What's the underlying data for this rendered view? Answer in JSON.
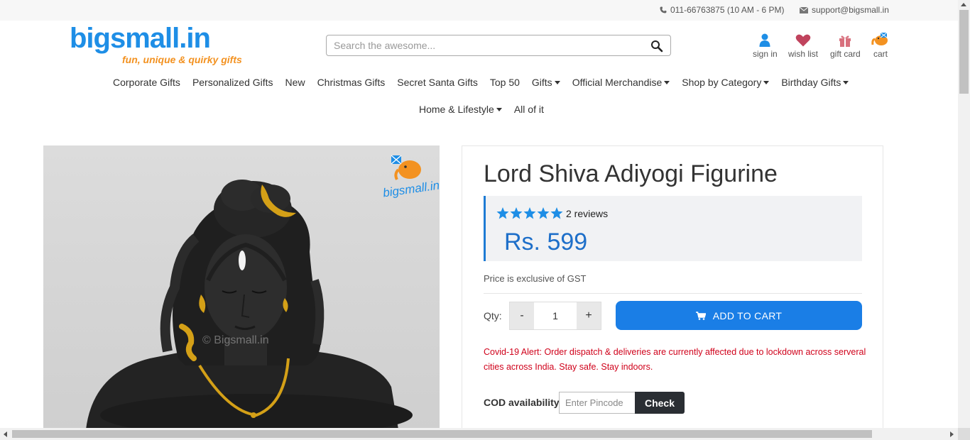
{
  "topbar": {
    "phone": "011-66763875 (10 AM - 6 PM)",
    "email": "support@bigsmall.in",
    "phone_icon": "phone-icon",
    "email_icon": "envelope-icon"
  },
  "header": {
    "logo_text": "bigsmall.in",
    "logo_tagline": "fun, unique & quirky gifts",
    "search_placeholder": "Search the awesome...",
    "search_icon": "magnifier-icon",
    "icons": [
      {
        "label": "sign in",
        "icon": "user-icon"
      },
      {
        "label": "wish list",
        "icon": "heart-icon"
      },
      {
        "label": "gift card",
        "icon": "gift-icon"
      },
      {
        "label": "cart",
        "icon": "cart-elephant-icon"
      }
    ]
  },
  "nav": {
    "row1": [
      {
        "label": "Corporate Gifts",
        "dropdown": false
      },
      {
        "label": "Personalized Gifts",
        "dropdown": false
      },
      {
        "label": "New",
        "dropdown": false
      },
      {
        "label": "Christmas Gifts",
        "dropdown": false
      },
      {
        "label": "Secret Santa Gifts",
        "dropdown": false
      },
      {
        "label": "Top 50",
        "dropdown": false
      },
      {
        "label": "Gifts",
        "dropdown": true
      },
      {
        "label": "Official Merchandise",
        "dropdown": true
      },
      {
        "label": "Shop by Category",
        "dropdown": true
      },
      {
        "label": "Birthday Gifts",
        "dropdown": true
      }
    ],
    "row2": [
      {
        "label": "Home & Lifestyle",
        "dropdown": true
      },
      {
        "label": "All of it",
        "dropdown": false
      }
    ]
  },
  "product": {
    "title": "Lord Shiva Adiyogi Figurine",
    "rating_stars": 5,
    "reviews": "2 reviews",
    "price": "Rs. 599",
    "gst_note": "Price is exclusive of GST",
    "qty_label": "Qty:",
    "qty_minus": "-",
    "qty_value": "1",
    "qty_plus": "+",
    "add_to_cart": "ADD TO CART",
    "alert": "Covid-19 Alert: Order dispatch & deliveries are currently affected due to lockdown across serveral cities across India. Stay safe. Stay indoors.",
    "cod_label": "COD availability",
    "pincode_placeholder": "Enter Pincode",
    "check_label": "Check",
    "image_watermark": "© Bigsmall.in",
    "image_logo_text": "bigsmall.in"
  },
  "colors": {
    "brand_blue": "#1e8ee6",
    "brand_orange": "#f39221",
    "cart_button": "#1a7ee6",
    "price": "#1e6fc9",
    "alert": "#d0021b",
    "star": "#1e8ee6"
  }
}
